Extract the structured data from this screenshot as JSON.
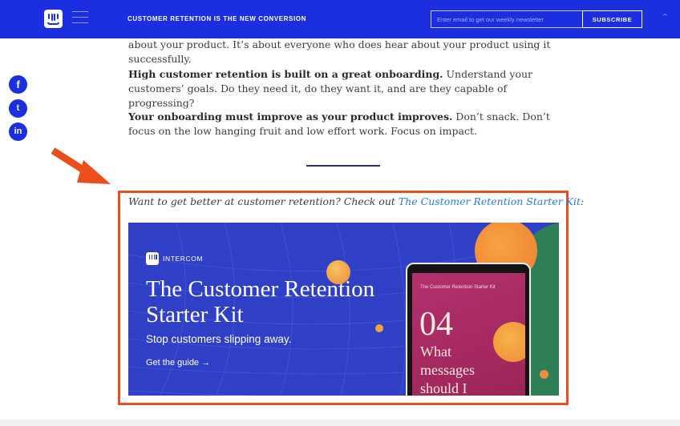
{
  "header": {
    "title": "CUSTOMER RETENTION IS THE NEW CONVERSION",
    "email_placeholder": "Enter email to get our weekly newsletter",
    "subscribe_label": "SUBSCRIBE",
    "scroll_top_glyph": "^",
    "logo_icon": "intercom-logo-icon",
    "menu_icon": "hamburger-menu-icon"
  },
  "social": {
    "facebook": "f",
    "twitter": "t",
    "linkedin": "in"
  },
  "article": {
    "p0": "about your product. It’s about everyone who does hear about your product using it successfully.",
    "p1_bold": "High customer retention is built on a great onboarding.",
    "p1_text": " Understand your customers’ goals. Do they need it, do they want it, and are they capable of progressing?",
    "p2_bold": "Your onboarding must improve as your product improves.",
    "p2_text": " Don’t snack. Don’t focus on the low hanging fruit and low effort work. Focus on impact."
  },
  "promo": {
    "intro": "Want to get better at customer retention? Check out ",
    "link_text": "The Customer Retention Starter Kit",
    "intro_end": ":"
  },
  "banner": {
    "brand": "INTERCOM",
    "title": "The Customer Retention Starter Kit",
    "subtitle": "Stop customers slipping away.",
    "cta": "Get the guide →",
    "tablet_kit": "The Customer Retention Starter Kit",
    "tablet_number": "04",
    "tablet_line1": "What",
    "tablet_line2": "messages",
    "tablet_line3": "should I"
  },
  "colors": {
    "brand_blue": "#1b2fe0",
    "annotation_orange": "#e94e1b",
    "link_blue": "#1f7fd6"
  }
}
